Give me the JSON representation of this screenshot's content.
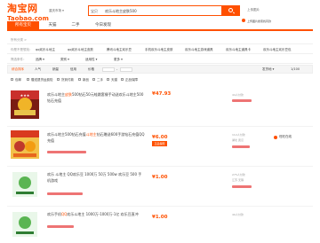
{
  "logo": {
    "cn": "淘宝网",
    "en": "Taobao.com"
  },
  "header": {
    "region": "重庆市场",
    "search_category": "宝贝",
    "search_query": "欢乐斗地主皮肤500",
    "side_link_1": "上传图片",
    "side_link_2": "上传图片搜索找同款"
  },
  "tabs": [
    {
      "label": "所有宝贝",
      "active": true
    },
    {
      "label": "天猫",
      "active": false
    },
    {
      "label": "二手",
      "active": false
    },
    {
      "label": "今日发现",
      "active": false
    }
  ],
  "filters": {
    "row1_label": "所有分类 >",
    "row2_label": "你是不是想找：",
    "row2_items": [
      "qq欢乐斗地主",
      "qq欢乐斗地主皮肤",
      "腾讯斗地主欢乐豆",
      "手机欢乐斗地主皮肤",
      "欢乐斗地主游戏道具",
      "欢乐斗地主道具卡",
      "欢乐斗地主欢乐豆包"
    ],
    "row3_label": "筛选条件：",
    "row3_items": [
      "品牌",
      "类别",
      "适用性",
      "更多"
    ]
  },
  "sortbar": {
    "items": [
      "综合排序",
      "人气",
      "销量",
      "信用",
      "价格"
    ],
    "active": "综合排序",
    "price_sep": "-",
    "right": [
      "发货地",
      "1/100"
    ]
  },
  "options": [
    "包邮",
    "赠送退货运费险",
    "货到付款",
    "新品",
    "二手",
    "天猫",
    "正品保障"
  ],
  "items": [
    {
      "title_pre": "欢乐斗地主",
      "title_hl": "皮肤",
      "title_post": "500钻石50元蛙跳套餐手动送欢乐斗地主500钻石充值",
      "price": "¥47.93",
      "sold": "44人付款",
      "location": ""
    },
    {
      "title_pre": "欢乐斗地主500钻石充值",
      "title_hl": "斗地主",
      "title_post": "钻石赠送600手游钻石充值QQ充值",
      "price": "¥6.00",
      "badge": "正品保障",
      "sold": "112人付款",
      "location": "湖北 武汉",
      "wangwang": "旺旺在线"
    },
    {
      "title_pre": "欢乐 斗地主 QQ欢乐豆 1000万 50万 500w 欢乐豆 500 手机游戏",
      "title_hl": "",
      "title_post": "",
      "price": "¥1.00",
      "sold": "275人付款",
      "location": "江苏 无锡"
    },
    {
      "title_pre": "欢乐手机",
      "title_hl": "QQ",
      "title_post": "欢乐斗地主 1000万-1000万-1亿 欢乐豆直冲",
      "price": "¥1.00",
      "sold": "40人付款",
      "location": ""
    }
  ]
}
